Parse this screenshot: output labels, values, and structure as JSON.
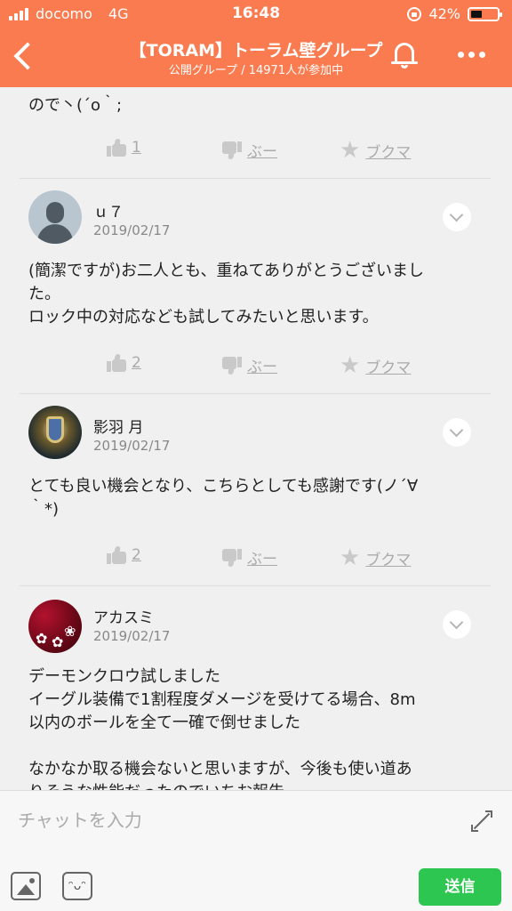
{
  "status_bar": {
    "carrier": "docomo",
    "network": "4G",
    "time": "16:48",
    "battery": "42%",
    "battery_level": 0.42
  },
  "header": {
    "title": "【TORAM】トーラム壁グループ",
    "subtitle": "公開グループ / 14971人が参加中",
    "background_color": "#f97b4f"
  },
  "previous_message": {
    "tail_text": "ので丶(´o｀;",
    "actions": {
      "like_count": "1",
      "boo_label": "ぶー",
      "bookmark_label": "ブクマ"
    }
  },
  "messages": [
    {
      "author": "ｕ７",
      "date": "2019/02/17",
      "avatar": "default-avatar",
      "lines": [
        "(簡潔ですが)お二人とも、重ねてありがとうございまし",
        "た。",
        "ロック中の対応なども試してみたいと思います。"
      ],
      "actions": {
        "like_count": "2",
        "boo_label": "ぶー",
        "bookmark_label": "ブクマ"
      }
    },
    {
      "author": "影羽 月",
      "date": "2019/02/17",
      "avatar": "crest-avatar",
      "lines": [
        "とても良い機会となり、こちらとしても感謝です(ノ´∀",
        "｀*)"
      ],
      "actions": {
        "like_count": "2",
        "boo_label": "ぶー",
        "bookmark_label": "ブクマ"
      }
    },
    {
      "author": "アカスミ",
      "date": "2019/02/17",
      "avatar": "flower-avatar",
      "lines": [
        "デーモンクロウ試しました",
        "イーグル装備で1割程度ダメージを受けてる場合、8m",
        "以内のボールを全て一確で倒せました",
        "",
        "なかなか取る機会ないと思いますが、今後も使い道あ",
        "りそうな性能だったのでいちお報告"
      ]
    }
  ],
  "composer": {
    "placeholder": "チャットを入力",
    "send_label": "送信",
    "send_color": "#2dc651"
  }
}
